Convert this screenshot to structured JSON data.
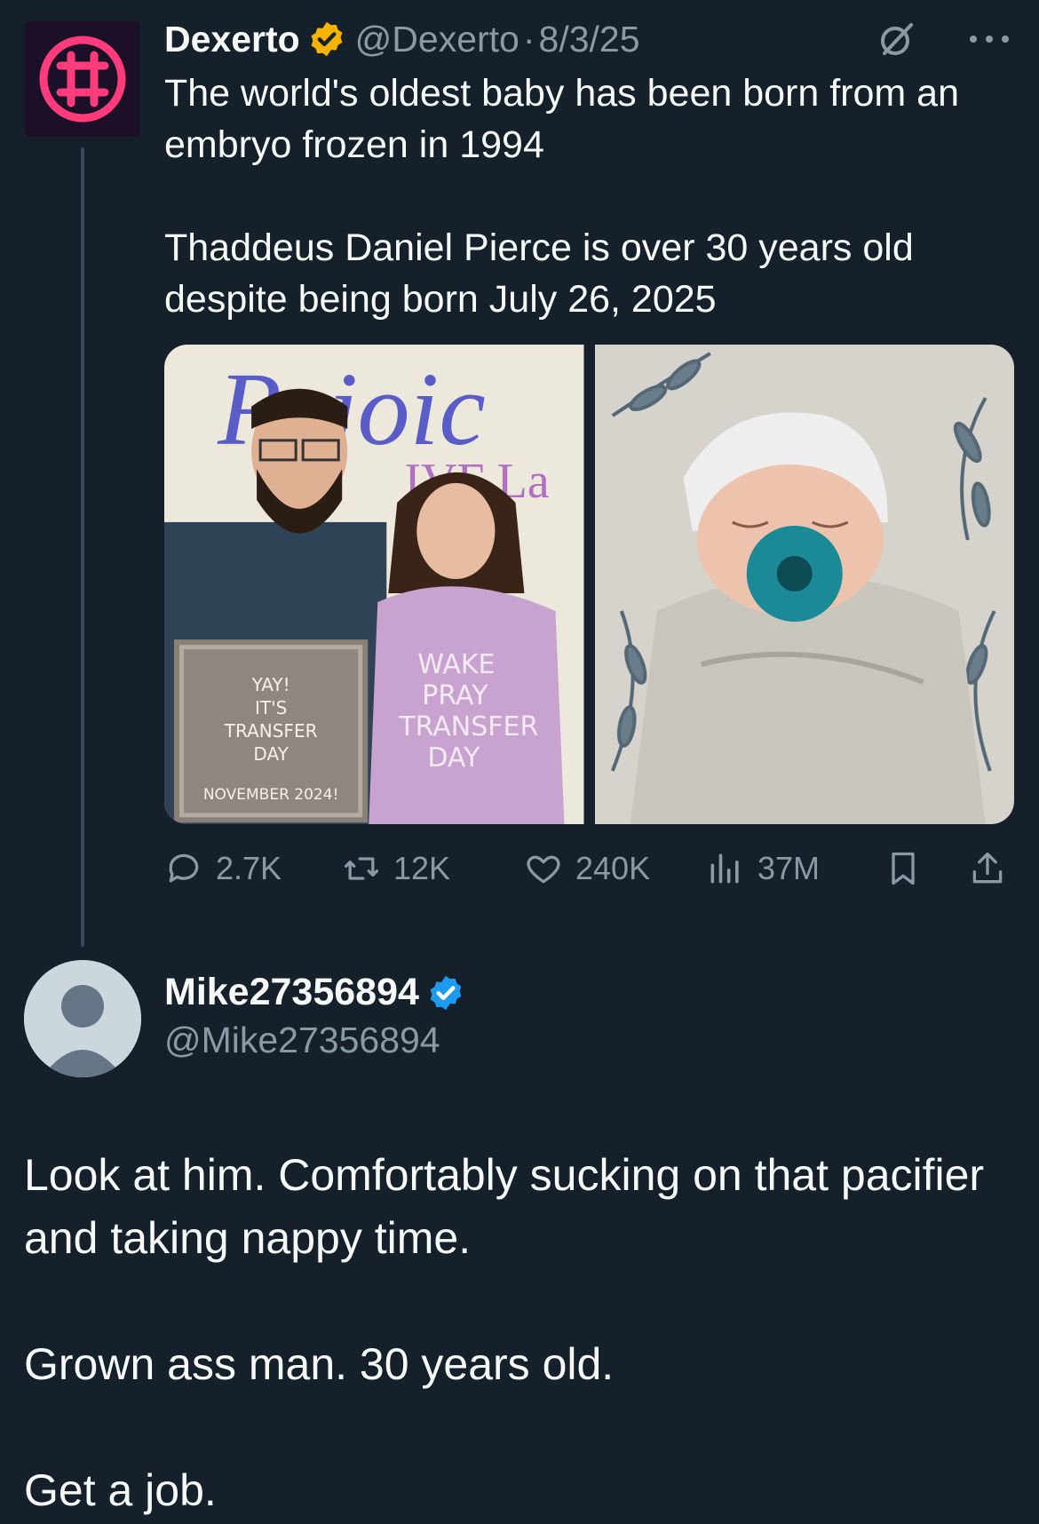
{
  "tweet": {
    "author_name": "Dexerto",
    "author_handle": "@Dexerto",
    "separator": "·",
    "date": "8/3/25",
    "text_line_1": "The world's oldest baby has been born from an embryo frozen in 1994",
    "text_line_2": "Thaddeus Daniel Pierce is over 30 years old despite being born July 26, 2025",
    "verified_color": "#f4b400",
    "media": {
      "left_photo": {
        "sign_letters": "Rejoic",
        "sign_sub": "IVF La",
        "board_lines": [
          "YAY!",
          "IT'S",
          "TRANSFER",
          "DAY"
        ],
        "board_footer": "NOVEMBER 2024!",
        "shirt_lines": [
          "WAKE",
          "PRAY",
          "TRANSFER",
          "DAY"
        ]
      }
    },
    "metrics": {
      "replies": "2.7K",
      "retweets": "12K",
      "likes": "240K",
      "views": "37M"
    }
  },
  "reply": {
    "author_name": "Mike27356894",
    "author_handle": "@Mike27356894",
    "verified_color": "#1d9bf0",
    "text_line_1": "Look at him. Comfortably sucking on that pacifier and taking nappy time.",
    "text_line_2": "Grown ass man. 30 years old.",
    "text_line_3": "Get a job."
  },
  "icons": [
    "verified-badge-gold",
    "grok-icon",
    "more-icon",
    "reply-icon",
    "retweet-icon",
    "like-icon",
    "views-icon",
    "bookmark-icon",
    "share-icon",
    "verified-badge-blue",
    "default-avatar"
  ]
}
